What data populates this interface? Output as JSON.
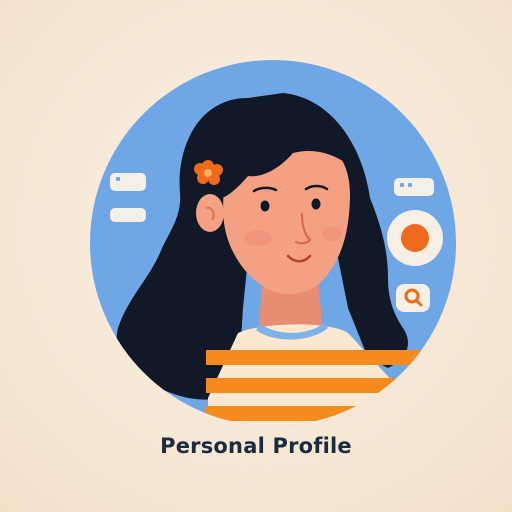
{
  "profile": {
    "title": "Personal Profile"
  },
  "icons": {
    "left_top": "browser-window-icon",
    "left_bottom": "text-field-icon",
    "right_top": "browser-window-icon",
    "right_middle": "toggle-dot-icon",
    "right_bottom": "search-icon",
    "hair_accessory": "flower-icon"
  },
  "colors": {
    "circle": "#6fa7e6",
    "hair": "#111827",
    "skin": "#f3a083",
    "shirt_orange": "#f58a1f",
    "shirt_cream": "#fbe8cf",
    "collar": "#7fb2ea",
    "accent": "#ef6a1c",
    "title": "#1c2b3f"
  }
}
